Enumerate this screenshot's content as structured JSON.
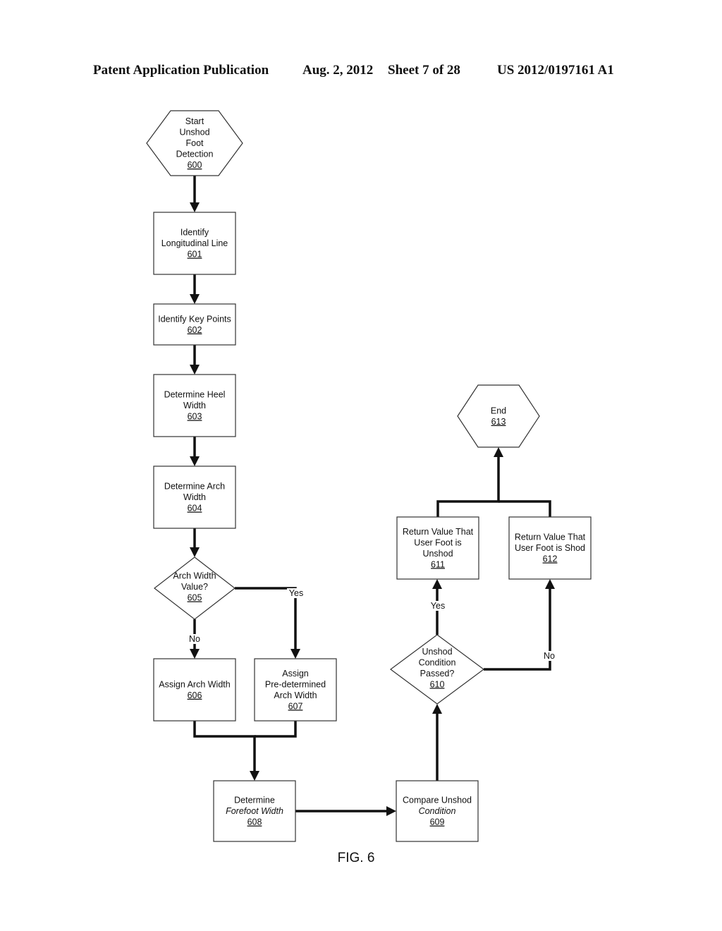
{
  "header": {
    "publication": "Patent Application Publication",
    "date": "Aug. 2, 2012",
    "sheet": "Sheet 7 of 28",
    "number": "US 2012/0197161 A1"
  },
  "figure_label": "FIG. 6",
  "nodes": [
    {
      "id": "600",
      "type": "hexagon",
      "lines": [
        "Start",
        "Unshod",
        "Foot",
        "Detection"
      ],
      "ref": "600"
    },
    {
      "id": "601",
      "type": "process",
      "lines": [
        "Identify",
        "Longitudinal Line"
      ],
      "ref": "601"
    },
    {
      "id": "602",
      "type": "process",
      "lines": [
        "Identify Key Points"
      ],
      "ref": "602"
    },
    {
      "id": "603",
      "type": "process",
      "lines": [
        "Determine Heel",
        "Width"
      ],
      "ref": "603"
    },
    {
      "id": "604",
      "type": "process",
      "lines": [
        "Determine Arch",
        "Width"
      ],
      "ref": "604"
    },
    {
      "id": "605",
      "type": "decision",
      "lines": [
        "Arch Width",
        "Value?"
      ],
      "ref": "605"
    },
    {
      "id": "606",
      "type": "process",
      "lines": [
        "Assign Arch Width"
      ],
      "ref": "606"
    },
    {
      "id": "607",
      "type": "process",
      "lines": [
        "Assign",
        "Pre-determined",
        "Arch Width"
      ],
      "ref": "607"
    },
    {
      "id": "608",
      "type": "process",
      "lines": [
        "Determine",
        "Forefoot Width"
      ],
      "ref": "608"
    },
    {
      "id": "609",
      "type": "process",
      "lines": [
        "Compare Unshod",
        "Condition"
      ],
      "ref": "609"
    },
    {
      "id": "610",
      "type": "decision",
      "lines": [
        "Unshod",
        "Condition",
        "Passed?"
      ],
      "ref": "610"
    },
    {
      "id": "611",
      "type": "process",
      "lines": [
        "Return Value That",
        "User Foot is",
        "Unshod"
      ],
      "ref": "611"
    },
    {
      "id": "612",
      "type": "process",
      "lines": [
        "Return Value That",
        "User Foot is Shod"
      ],
      "ref": "612"
    },
    {
      "id": "613",
      "type": "hexagon",
      "lines": [
        "End"
      ],
      "ref": "613"
    }
  ],
  "edges": [
    {
      "from": "600",
      "to": "601",
      "label": ""
    },
    {
      "from": "601",
      "to": "602",
      "label": ""
    },
    {
      "from": "602",
      "to": "603",
      "label": ""
    },
    {
      "from": "603",
      "to": "604",
      "label": ""
    },
    {
      "from": "604",
      "to": "605",
      "label": ""
    },
    {
      "from": "605",
      "to": "606",
      "label": "No"
    },
    {
      "from": "605",
      "to": "607",
      "label": "Yes"
    },
    {
      "from": "606",
      "to": "608",
      "label": ""
    },
    {
      "from": "607",
      "to": "608",
      "label": ""
    },
    {
      "from": "608",
      "to": "609",
      "label": ""
    },
    {
      "from": "609",
      "to": "610",
      "label": ""
    },
    {
      "from": "610",
      "to": "611",
      "label": "Yes"
    },
    {
      "from": "610",
      "to": "612",
      "label": "No"
    },
    {
      "from": "611",
      "to": "613",
      "label": ""
    },
    {
      "from": "612",
      "to": "613",
      "label": ""
    }
  ]
}
